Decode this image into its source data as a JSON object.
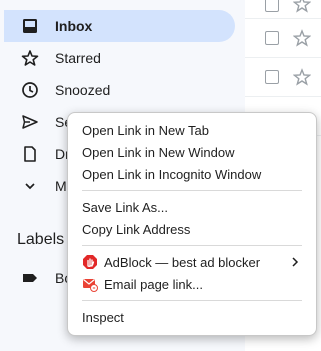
{
  "sidebar": {
    "items": [
      {
        "label": "Inbox",
        "icon": "inbox-icon",
        "active": true
      },
      {
        "label": "Starred",
        "icon": "star-icon"
      },
      {
        "label": "Snoozed",
        "icon": "clock-icon"
      },
      {
        "label": "Se",
        "icon": "send-icon"
      },
      {
        "label": "Dr",
        "icon": "draft-icon"
      },
      {
        "label": "Mo",
        "icon": "chevron-down-icon"
      }
    ],
    "labels_heading": "Labels",
    "label_items": [
      {
        "label": "Bo",
        "icon": "label-tag-icon"
      }
    ]
  },
  "context_menu": {
    "items": [
      {
        "label": "Open Link in New Tab"
      },
      {
        "label": "Open Link in New Window"
      },
      {
        "label": "Open Link in Incognito Window"
      },
      {
        "label": "Save Link As..."
      },
      {
        "label": "Copy Link Address"
      },
      {
        "label": "AdBlock — best ad blocker",
        "icon": "adblock-icon",
        "submenu": true
      },
      {
        "label": "Email page link...",
        "icon": "email-link-icon"
      },
      {
        "label": "Inspect"
      }
    ]
  },
  "colors": {
    "active_nav": "#d3e3fd",
    "adblock_red": "#e22828",
    "email_red": "#ea4335"
  }
}
